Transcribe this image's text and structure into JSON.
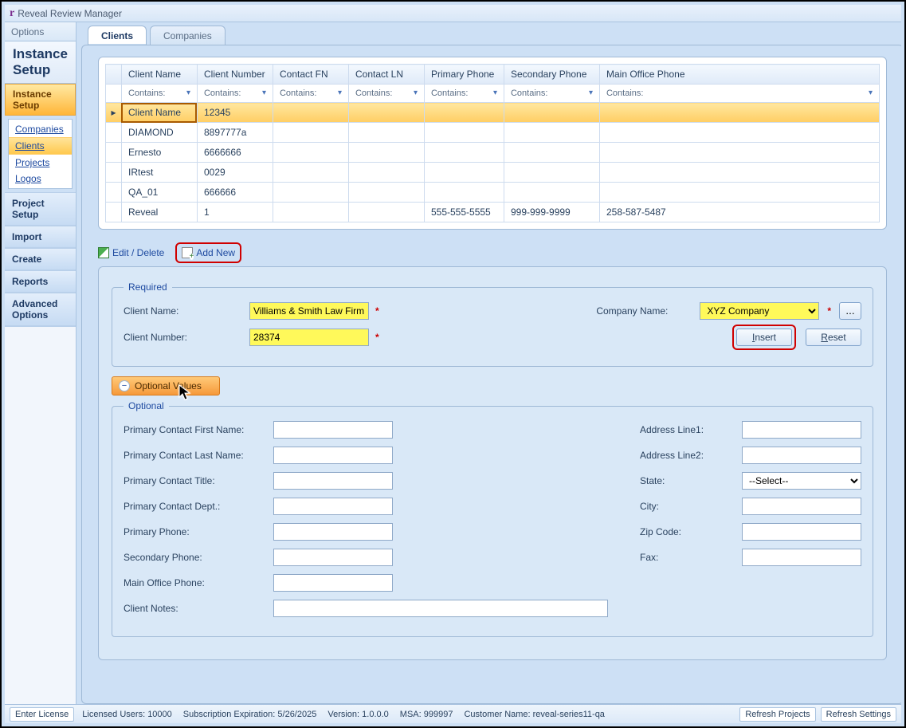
{
  "window": {
    "title": "Reveal Review Manager",
    "options": "Options"
  },
  "sidebar": {
    "panel_title": "Instance Setup",
    "section_hdr": "Instance Setup",
    "nav": [
      "Companies",
      "Clients",
      "Projects",
      "Logos"
    ],
    "nav_selected_index": 1,
    "sections": [
      "Project Setup",
      "Import",
      "Create",
      "Reports",
      "Advanced Options"
    ]
  },
  "tabs": {
    "items": [
      "Clients",
      "Companies"
    ],
    "active_index": 0
  },
  "grid": {
    "columns": [
      "Client Name",
      "Client Number",
      "Contact FN",
      "Contact LN",
      "Primary Phone",
      "Secondary Phone",
      "Main Office Phone"
    ],
    "filter_label": "Contains:",
    "rows": [
      {
        "name": "Client Name",
        "num": "12345",
        "cfn": "",
        "cln": "",
        "pp": "",
        "sp": "",
        "mop": ""
      },
      {
        "name": "DIAMOND",
        "num": "8897777a",
        "cfn": "",
        "cln": "",
        "pp": "",
        "sp": "",
        "mop": ""
      },
      {
        "name": "Ernesto",
        "num": "6666666",
        "cfn": "",
        "cln": "",
        "pp": "",
        "sp": "",
        "mop": ""
      },
      {
        "name": "IRtest",
        "num": "0029",
        "cfn": "",
        "cln": "",
        "pp": "",
        "sp": "",
        "mop": ""
      },
      {
        "name": "QA_01",
        "num": "666666",
        "cfn": "",
        "cln": "",
        "pp": "",
        "sp": "",
        "mop": ""
      },
      {
        "name": "Reveal",
        "num": "1",
        "cfn": "",
        "cln": "",
        "pp": "555-555-5555",
        "sp": "999-999-9999",
        "mop": "258-587-5487"
      }
    ],
    "selected_row_index": 0
  },
  "actions": {
    "edit_delete": "Edit / Delete",
    "add_new": "Add New"
  },
  "form": {
    "required_legend": "Required",
    "client_name_label": "Client Name:",
    "client_name_value": "Villiams & Smith Law Firm",
    "client_number_label": "Client Number:",
    "client_number_value": "28374",
    "company_name_label": "Company Name:",
    "company_name_value": "XYZ Company",
    "insert_label": "Insert",
    "reset_label": "Reset",
    "ellipsis": "...",
    "expander_label": "Optional Values",
    "optional_legend": "Optional",
    "labels": {
      "pcfn": "Primary Contact First Name:",
      "pcln": "Primary Contact Last Name:",
      "pct": "Primary Contact Title:",
      "pcd": "Primary Contact Dept.:",
      "pp": "Primary Phone:",
      "sp": "Secondary Phone:",
      "mop": "Main Office Phone:",
      "notes": "Client Notes:",
      "a1": "Address Line1:",
      "a2": "Address Line2:",
      "state": "State:",
      "city": "City:",
      "zip": "Zip Code:",
      "fax": "Fax:"
    },
    "state_placeholder": "--Select--"
  },
  "status": {
    "enter_license": "Enter License",
    "licensed_users": "Licensed Users: 10000",
    "sub_exp": "Subscription Expiration: 5/26/2025",
    "version": "Version: 1.0.0.0",
    "msa": "MSA: 999997",
    "customer": "Customer Name: reveal-series11-qa",
    "refresh_projects": "Refresh Projects",
    "refresh_settings": "Refresh Settings"
  }
}
